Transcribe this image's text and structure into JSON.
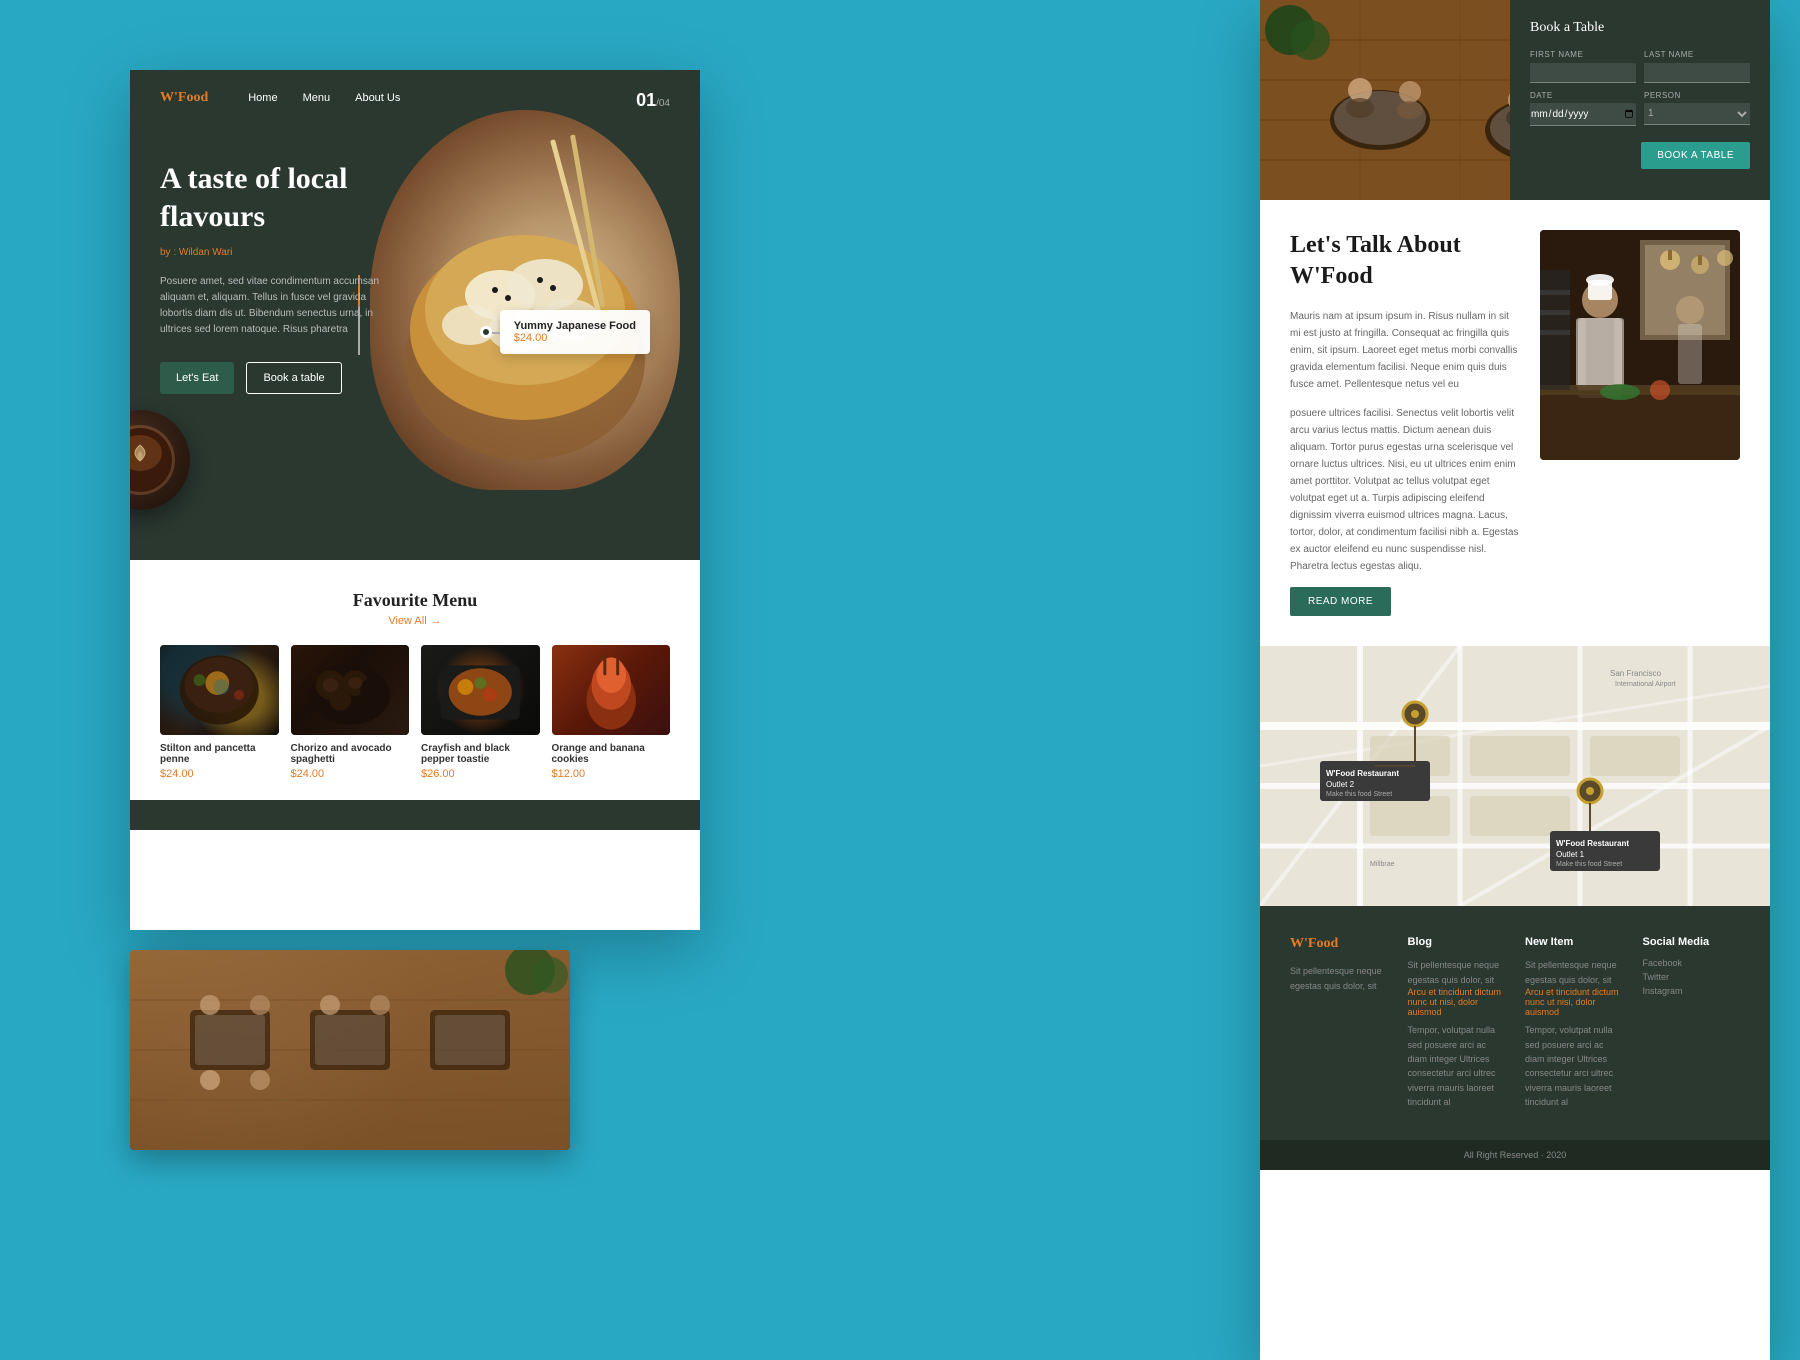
{
  "site": {
    "logo": "W'Food",
    "nav": [
      "Home",
      "Menu",
      "About Us"
    ],
    "counter": {
      "current": "01",
      "total": "/04"
    }
  },
  "hero": {
    "title": "A taste of local flavours",
    "author": "by : Wildan Wari",
    "description": "Posuere amet, sed vitae condimentum accumsan aliquam et, aliquam. Tellus in fusce vel gravida lobortis diam dis ut. Bibendum senectus urna, in ultrices sed lorem natoque. Risus pharetra",
    "btn_eat": "Let's Eat",
    "btn_table": "Book a table",
    "food_label": "Yummy Japanese Food",
    "food_price": "$24.00"
  },
  "menu": {
    "title": "Favourite Menu",
    "view_all": "View All",
    "items": [
      {
        "name": "Stilton and pancetta penne",
        "price": "$24.00"
      },
      {
        "name": "Chorizo and avocado spaghetti",
        "price": "$24.00"
      },
      {
        "name": "Crayfish and black pepper toastie",
        "price": "$26.00"
      },
      {
        "name": "Orange and banana cookies",
        "price": "$12.00"
      }
    ]
  },
  "book_table": {
    "title": "Book a Table",
    "first_name_label": "FIRST NAME",
    "last_name_label": "LAST NAME",
    "date_label": "DATE",
    "person_label": "PERSON",
    "button": "BOOK A TABLE"
  },
  "talk": {
    "title": "Let's Talk About W'Food",
    "paragraph1": "Mauris nam at ipsum ipsum in. Risus nullam in sit mi est justo at fringilla. Consequat ac fringilla quis enim, sit ipsum. Laoreet eget metus morbi convallis gravida elementum facilisi. Neque enim quis duis fusce amet. Pellentesque netus vel eu",
    "paragraph2": "posuere ultrices facilisi. Senectus velit lobortis velit arcu varius lectus mattis. Dictum aenean duis aliquam. Tortor purus egestas urna scelerisque vel ornare luctus ultrices. Nisi, eu ut ultrices enim enim amet porttitor. Volutpat ac tellus volutpat eget volutpat eget ut a. Turpis adipiscing eleifend dignissim viverra euismod ultrices magna. Lacus, tortor, dolor, at condimentum facilisi nibh a. Egestas ex auctor eleifend eu nunc suspendisse nisl. Pharetra lectus egestas aliqu.",
    "read_more": "READ MORE"
  },
  "locations": {
    "outlet1": {
      "name": "W'Food Restaurant Outlet 2",
      "address": "Make this food Street Location"
    },
    "outlet2": {
      "name": "W'Food Restaurant Outlet 1",
      "address": "Make this food Street Location"
    }
  },
  "footer": {
    "logo": "W'Food",
    "description": "Sit pellentesque neque egestas quis dolor, sit",
    "blog_title": "Blog",
    "blog_desc": "Sit pellentesque neque egestas quis dolor, sit",
    "blog_link": "Arcu et tincidunt dictum nunc ut nisi, dolor auismod",
    "blog_text": "Tempor, volutpat nulla sed posuere arci ac diam integer\n\nUltrices consectetur arci ultrec viverra mauris laoreet tincidunt al",
    "new_item_title": "New Item",
    "new_item_desc": "Sit pellentesque neque egestas quis dolor, sit",
    "new_item_link": "Arcu et tincidunt dictum nunc ut nisi, dolor auismod",
    "new_item_text": "Tempor, volutpat nulla sed posuere arci ac diam integer\n\nUltrices consectetur arci ultrec viverra mauris laoreet tincidunt al",
    "social_title": "Social Media",
    "social_links": [
      "Facebook",
      "Twitter",
      "Instagram"
    ],
    "copyright": "All Right Reserved · 2020"
  }
}
